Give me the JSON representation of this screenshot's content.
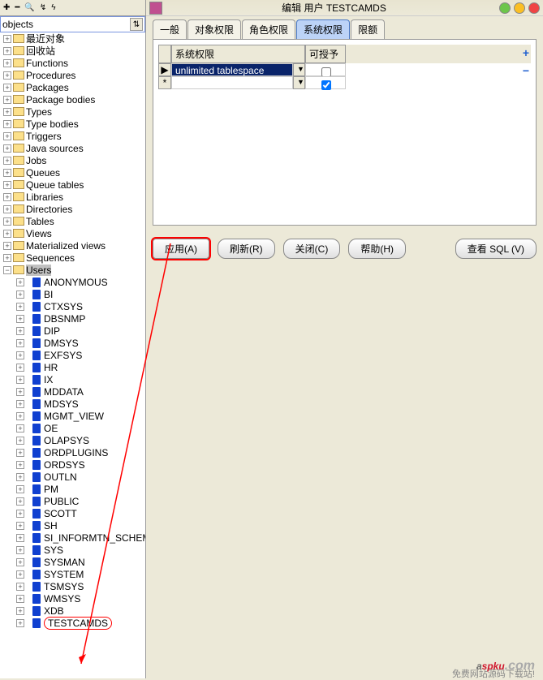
{
  "window_title": "编辑 用户 TESTCAMDS",
  "left": {
    "dropdown_value": "objects",
    "folders": [
      "最近对象",
      "回收站",
      "Functions",
      "Procedures",
      "Packages",
      "Package bodies",
      "Types",
      "Type bodies",
      "Triggers",
      "Java sources",
      "Jobs",
      "Queues",
      "Queue tables",
      "Libraries",
      "Directories",
      "Tables",
      "Views",
      "Materialized views",
      "Sequences",
      "Users"
    ],
    "users": [
      "ANONYMOUS",
      "BI",
      "CTXSYS",
      "DBSNMP",
      "DIP",
      "DMSYS",
      "EXFSYS",
      "HR",
      "IX",
      "MDDATA",
      "MDSYS",
      "MGMT_VIEW",
      "OE",
      "OLAPSYS",
      "ORDPLUGINS",
      "ORDSYS",
      "OUTLN",
      "PM",
      "PUBLIC",
      "SCOTT",
      "SH",
      "SI_INFORMTN_SCHEMA",
      "SYS",
      "SYSMAN",
      "SYSTEM",
      "TSMSYS",
      "WMSYS",
      "XDB",
      "TESTCAMDS"
    ]
  },
  "tabs": [
    "一般",
    "对象权限",
    "角色权限",
    "系统权限",
    "限额"
  ],
  "active_tab": "系统权限",
  "grid": {
    "header_priv": "系统权限",
    "header_grant": "可授予",
    "rows": [
      {
        "marker": "▶",
        "priv": "unlimited tablespace",
        "selected": true,
        "grant": false
      },
      {
        "marker": "*",
        "priv": "",
        "selected": false,
        "grant": true
      }
    ]
  },
  "buttons": {
    "apply": "应用(A)",
    "refresh": "刷新(R)",
    "close": "关闭(C)",
    "help": "帮助(H)",
    "view_sql": "查看 SQL (V)"
  },
  "watermark": {
    "prefix": "a",
    "mid": "spku",
    "suffix": ".com",
    "sub": "免费网站源码下载站!"
  }
}
